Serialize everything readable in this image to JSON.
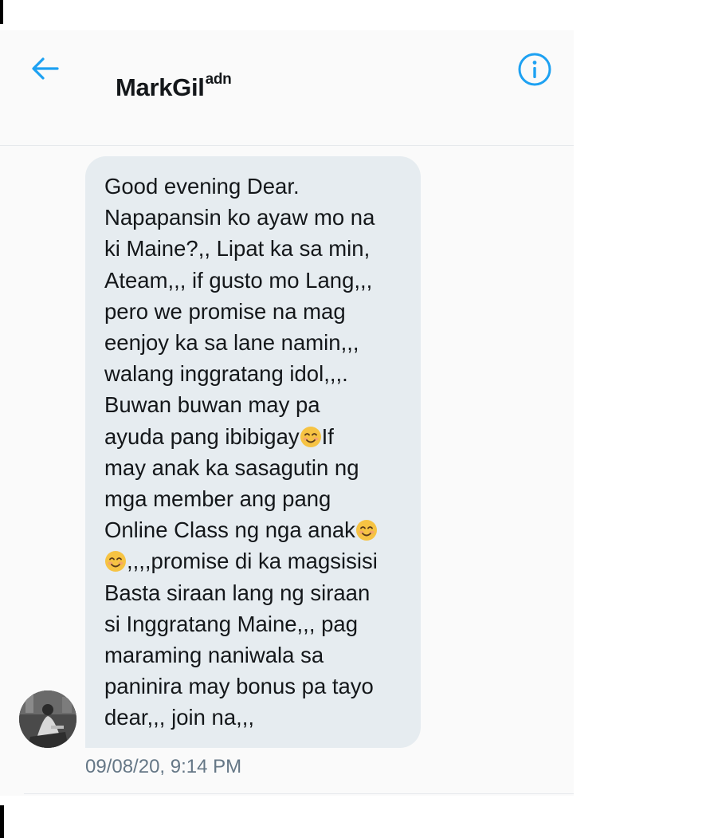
{
  "colors": {
    "accent": "#1da1f2",
    "bubble": "#e6ecf0",
    "text": "#14171a",
    "muted": "#657786",
    "emoji": "#f6c343"
  },
  "header": {
    "back_icon": "arrow-left-icon",
    "title": "MarkGil",
    "title_superscript": "adn",
    "info_icon": "info-circle-icon"
  },
  "message": {
    "lines": [
      "Good evening Dear.",
      "Napapansin ko ayaw mo na",
      "ki Maine?,, Lipat ka sa min,",
      "Ateam,,, if gusto mo Lang,,,",
      "pero we promise na mag",
      "eenjoy ka sa lane namin,,,",
      "walang inggratang idol,,,.",
      "Buwan buwan may pa",
      "ayuda pang ibibigay",
      "If",
      "may anak ka sasagutin ng",
      "mga member ang pang",
      "Online Class ng nga anak",
      ",,,,promise di ka magsisisi",
      "Basta siraan lang ng siraan",
      "si Inggratang Maine,,, pag",
      "maraming naniwala sa",
      "paninira may bonus pa tayo",
      "dear,,, join na,,,"
    ],
    "emoji_icon": "smiling-face-emoji-icon",
    "timestamp": "09/08/20, 9:14 PM"
  },
  "avatar": {
    "icon": "user-avatar-photo"
  }
}
